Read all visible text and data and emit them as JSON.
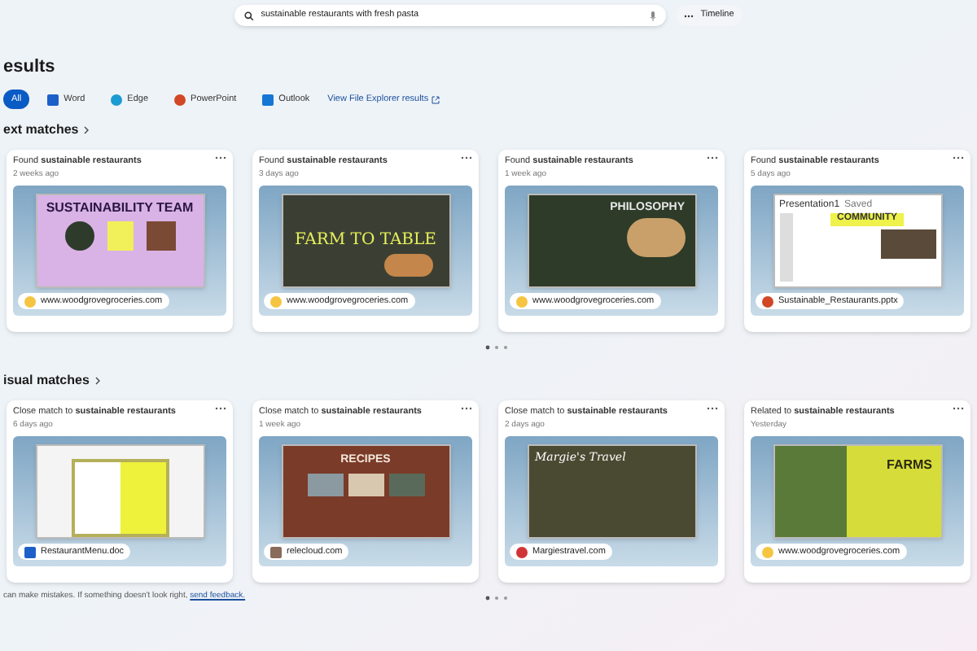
{
  "search": {
    "value": "sustainable restaurants with fresh pasta"
  },
  "timeline": {
    "label": "Timeline"
  },
  "heading": "esults",
  "filters": [
    {
      "label": "All",
      "kind": "all",
      "selected": true
    },
    {
      "label": "Word",
      "kind": "word",
      "selected": false
    },
    {
      "label": "Edge",
      "kind": "edge",
      "selected": false
    },
    {
      "label": "PowerPoint",
      "kind": "powerpoint",
      "selected": false
    },
    {
      "label": "Outlook",
      "kind": "outlook",
      "selected": false
    }
  ],
  "explorer_link": "View File Explorer results",
  "sections": [
    {
      "title": "ext matches",
      "cards": [
        {
          "prefix": "Found",
          "query": "sustainable restaurants",
          "time": "2 weeks ago",
          "thumb": {
            "kind": "team",
            "title": "SUSTAINABILITY TEAM"
          },
          "source": {
            "kind": "web",
            "label": "www.woodgrovegroceries.com"
          }
        },
        {
          "prefix": "Found",
          "query": "sustainable restaurants",
          "time": "3 days ago",
          "thumb": {
            "kind": "farm",
            "title": "FARM TO TABLE"
          },
          "source": {
            "kind": "web",
            "label": "www.woodgrovegroceries.com"
          }
        },
        {
          "prefix": "Found",
          "query": "sustainable restaurants",
          "time": "1 week ago",
          "thumb": {
            "kind": "philosophy",
            "title": "PHILOSOPHY"
          },
          "source": {
            "kind": "web",
            "label": "www.woodgrovegroceries.com"
          }
        },
        {
          "prefix": "Found",
          "query": "sustainable restaurants",
          "time": "5 days ago",
          "thumb": {
            "kind": "presentation",
            "window_title": "Presentation1",
            "status": "Saved",
            "title": "COMMUNITY"
          },
          "source": {
            "kind": "powerpoint",
            "label": "Sustainable_Restaurants.pptx"
          }
        }
      ]
    },
    {
      "title": "isual matches",
      "cards": [
        {
          "prefix": "Close match to",
          "query": "sustainable restaurants",
          "time": "6 days ago",
          "thumb": {
            "kind": "document"
          },
          "source": {
            "kind": "word",
            "label": "RestaurantMenu.doc"
          }
        },
        {
          "prefix": "Close match to",
          "query": "sustainable restaurants",
          "time": "1 week ago",
          "thumb": {
            "kind": "recipes",
            "title": "RECIPES"
          },
          "source": {
            "kind": "site",
            "label": "relecloud.com"
          }
        },
        {
          "prefix": "Close match to",
          "query": "sustainable restaurants",
          "time": "2 days ago",
          "thumb": {
            "kind": "travel",
            "title": "Margie's Travel"
          },
          "source": {
            "kind": "travel",
            "label": "Margiestravel.com"
          }
        },
        {
          "prefix": "Related to",
          "query": "sustainable restaurants",
          "time": "Yesterday",
          "thumb": {
            "kind": "farms",
            "title": "FARMS"
          },
          "source": {
            "kind": "web",
            "label": "www.woodgrovegroceries.com"
          }
        }
      ]
    }
  ],
  "footer": {
    "text": "can make mistakes. If something doesn't look right,",
    "link": "send feedback."
  }
}
